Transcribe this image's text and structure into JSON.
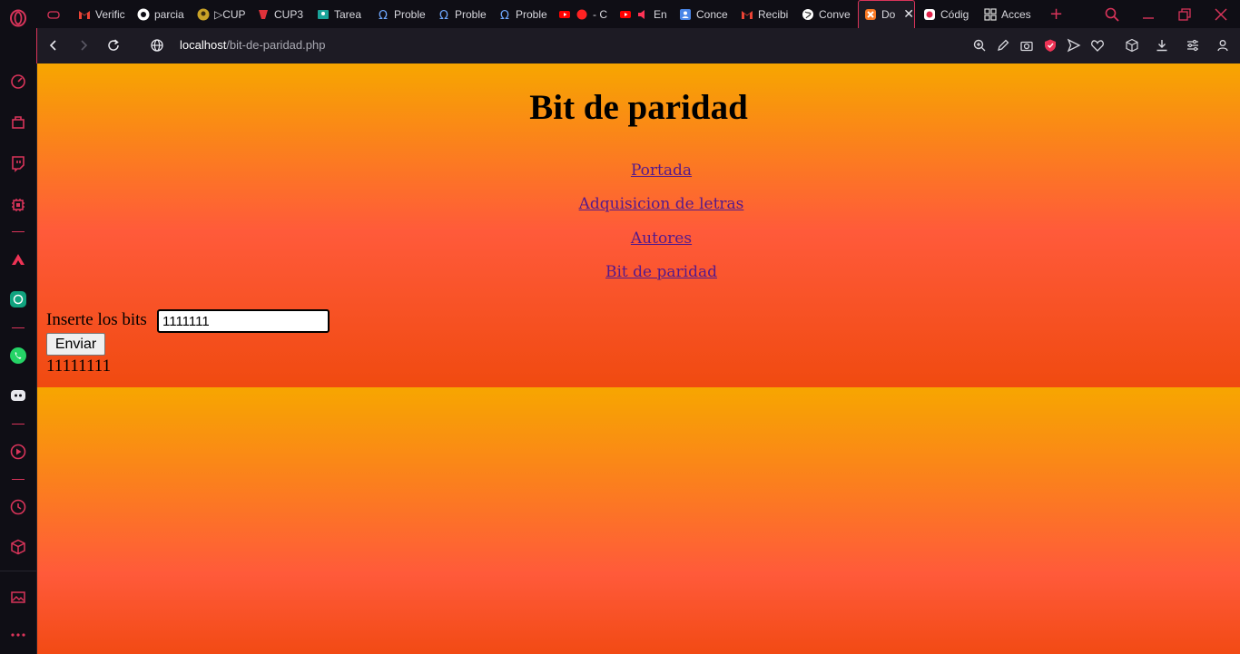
{
  "browser": {
    "tabs": [
      {
        "label": "",
        "icon": "gamepad-icon"
      },
      {
        "label": "Verific",
        "icon": "gmail-icon"
      },
      {
        "label": "parcia",
        "icon": "github-icon"
      },
      {
        "label": "▷CUP",
        "icon": "avatar-icon"
      },
      {
        "label": "CUP3",
        "icon": "cup-icon"
      },
      {
        "label": "Tarea",
        "icon": "classroom-icon"
      },
      {
        "label": "Proble",
        "icon": "omega-icon"
      },
      {
        "label": "Proble",
        "icon": "omega-icon"
      },
      {
        "label": "Proble",
        "icon": "omega-icon"
      },
      {
        "label": "- C",
        "icon": "youtube-icon"
      },
      {
        "label": "En",
        "icon": "youtube-icon"
      },
      {
        "label": "Conce",
        "icon": "contacts-icon"
      },
      {
        "label": "Recibi",
        "icon": "gmail-icon"
      },
      {
        "label": "Conve",
        "icon": "globe-icon"
      },
      {
        "label": "Do",
        "icon": "xampp-icon"
      },
      {
        "label": "Códig",
        "icon": "record-icon"
      },
      {
        "label": "Acces",
        "icon": "grid-icon"
      }
    ],
    "new_tab_label": "+",
    "address": {
      "host": "localhost",
      "path": "/bit-de-paridad.php"
    }
  },
  "page": {
    "title": "Bit de paridad",
    "nav_links": [
      "Portada",
      "Adquisicion de letras",
      "Autores",
      "Bit de paridad"
    ],
    "form": {
      "label": "Inserte los bits",
      "input_value": "1111111",
      "submit_label": "Enviar"
    },
    "result": "11111111"
  },
  "colors": {
    "gradient_top": "#f7a600",
    "gradient_mid": "#ff5a3a",
    "gradient_bottom": "#f04a10",
    "link": "#551a8b",
    "accent": "#d9345a"
  }
}
